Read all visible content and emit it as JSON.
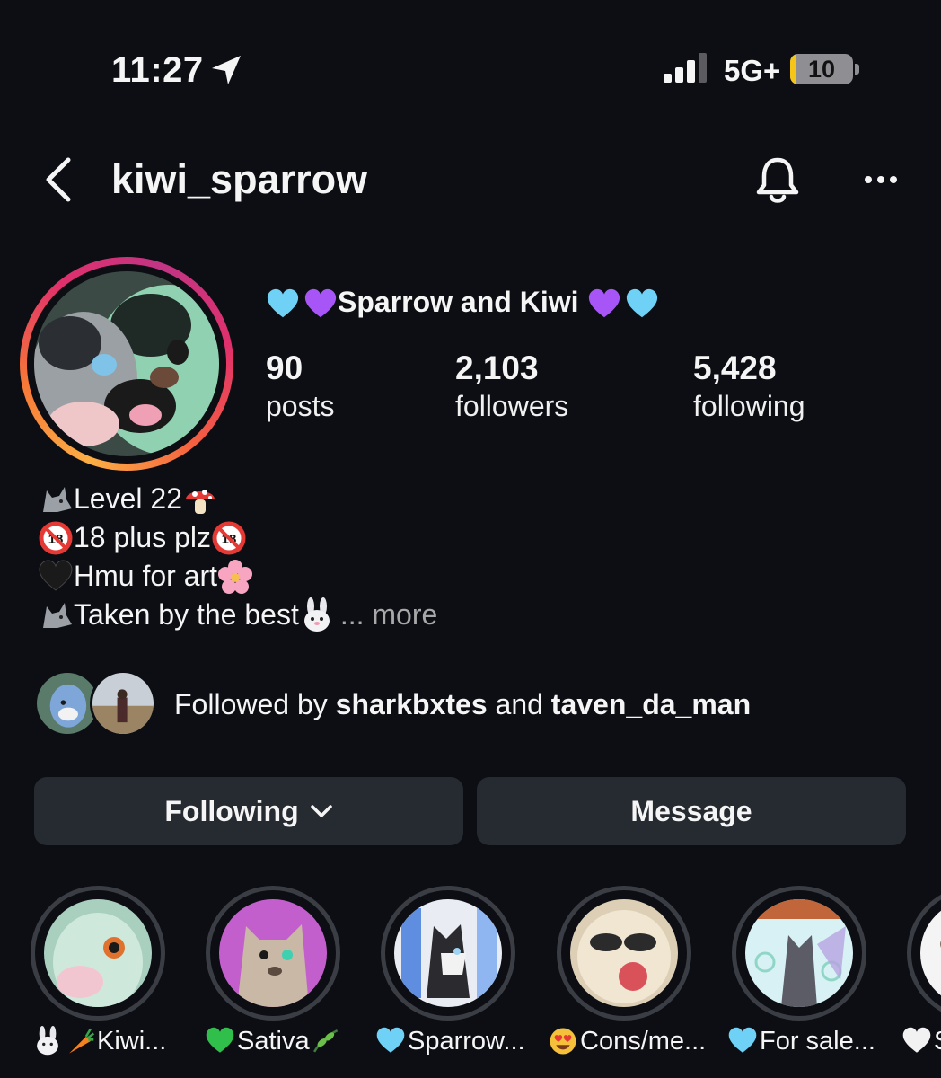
{
  "status_bar": {
    "time": "11:27",
    "network": "5G+",
    "battery_level": "10",
    "battery_fraction": 0.1,
    "icons": [
      "location-arrow-icon",
      "cellular-signal-icon",
      "battery-icon"
    ]
  },
  "header": {
    "username": "kiwi_sparrow",
    "icons": [
      "back-icon",
      "bell-icon",
      "more-icon"
    ]
  },
  "profile": {
    "display_name": "Sparrow and Kiwi",
    "display_name_emojis": [
      "light-blue-heart-icon",
      "purple-heart-icon"
    ],
    "stats": [
      {
        "value": "90",
        "label": "posts"
      },
      {
        "value": "2,103",
        "label": "followers"
      },
      {
        "value": "5,428",
        "label": "following"
      }
    ]
  },
  "bio": {
    "lines": [
      {
        "icon": "wolf-icon",
        "text": "Level 22",
        "trail_icon": "mushroom-icon"
      },
      {
        "icon": "no-under-18-icon",
        "text": "18 plus plz",
        "trail_icon": "no-under-18-icon"
      },
      {
        "icon": "black-heart-icon",
        "text": "Hmu for art",
        "trail_icon": "cherry-blossom-icon"
      },
      {
        "icon": "wolf-icon",
        "text": "Taken by the best",
        "trail_icon": "rabbit-icon"
      }
    ],
    "more_label": "... more"
  },
  "followed_by": {
    "prefix": "Followed by",
    "user1": "sharkbxtes",
    "joiner": "and",
    "user2": "taven_da_man"
  },
  "buttons": {
    "following": "Following",
    "message": "Message"
  },
  "highlights": [
    {
      "label": "Kiwi...",
      "icons": [
        "rabbit-icon",
        "carrot-icon"
      ]
    },
    {
      "label": "Sativa",
      "icons": [
        "green-heart-icon",
        "herb-icon"
      ]
    },
    {
      "label": "Sparrow...",
      "icons": [
        "light-blue-heart-icon"
      ]
    },
    {
      "label": "Cons/me...",
      "icons": [
        "heart-eyes-icon"
      ]
    },
    {
      "label": "For sale...",
      "icons": [
        "light-blue-heart-icon"
      ]
    },
    {
      "label": "S",
      "icons": [
        "white-heart-icon"
      ]
    }
  ],
  "colors": {
    "background": "#0c0e13",
    "button": "#262a31",
    "muted_text": "#a8a8a8",
    "battery_accent": "#f5c518"
  }
}
